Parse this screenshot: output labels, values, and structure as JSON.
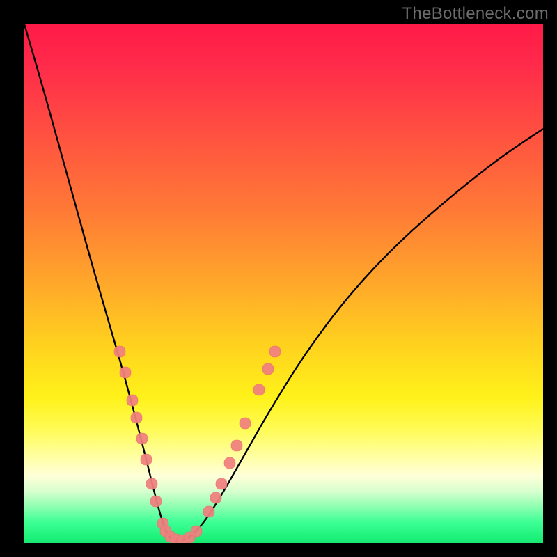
{
  "watermark": "TheBottleneck.com",
  "colors": {
    "background": "#000000",
    "curve": "#000000",
    "marker_fill": "#f08080",
    "marker_stroke": "#ec6a6a"
  },
  "chart_data": {
    "type": "line",
    "title": "",
    "xlabel": "",
    "ylabel": "",
    "xlim": [
      35,
      780
    ],
    "ylim": [
      35,
      780
    ],
    "series": [
      {
        "name": "bottleneck-curve",
        "description": "V-shaped bottleneck curve; y is mismatch percentage (0 at trough, ~100 at top)",
        "x": [
          35,
          60,
          85,
          110,
          135,
          160,
          180,
          200,
          215,
          225,
          232,
          238,
          244,
          250,
          260,
          275,
          295,
          320,
          350,
          390,
          440,
          500,
          570,
          650,
          720,
          780
        ],
        "y": [
          35,
          120,
          210,
          300,
          390,
          475,
          545,
          620,
          680,
          720,
          745,
          762,
          772,
          778,
          778,
          770,
          748,
          708,
          655,
          585,
          505,
          425,
          350,
          280,
          225,
          185
        ]
      }
    ],
    "markers": [
      {
        "name": "left-branch-points",
        "shape": "rounded",
        "points": [
          {
            "x": 172,
            "y": 505
          },
          {
            "x": 180,
            "y": 535
          },
          {
            "x": 190,
            "y": 575
          },
          {
            "x": 196,
            "y": 600
          },
          {
            "x": 204,
            "y": 630
          },
          {
            "x": 210,
            "y": 660
          },
          {
            "x": 218,
            "y": 695
          },
          {
            "x": 224,
            "y": 720
          }
        ]
      },
      {
        "name": "trough-points",
        "shape": "rounded",
        "points": [
          {
            "x": 234,
            "y": 752
          },
          {
            "x": 238,
            "y": 763
          },
          {
            "x": 245,
            "y": 771
          },
          {
            "x": 253,
            "y": 775
          },
          {
            "x": 262,
            "y": 776
          },
          {
            "x": 272,
            "y": 772
          },
          {
            "x": 282,
            "y": 763
          }
        ]
      },
      {
        "name": "right-branch-points",
        "shape": "rounded",
        "points": [
          {
            "x": 300,
            "y": 735
          },
          {
            "x": 310,
            "y": 715
          },
          {
            "x": 318,
            "y": 695
          },
          {
            "x": 330,
            "y": 665
          },
          {
            "x": 340,
            "y": 640
          },
          {
            "x": 352,
            "y": 608
          },
          {
            "x": 372,
            "y": 560
          },
          {
            "x": 385,
            "y": 530
          },
          {
            "x": 395,
            "y": 505
          }
        ]
      }
    ]
  }
}
